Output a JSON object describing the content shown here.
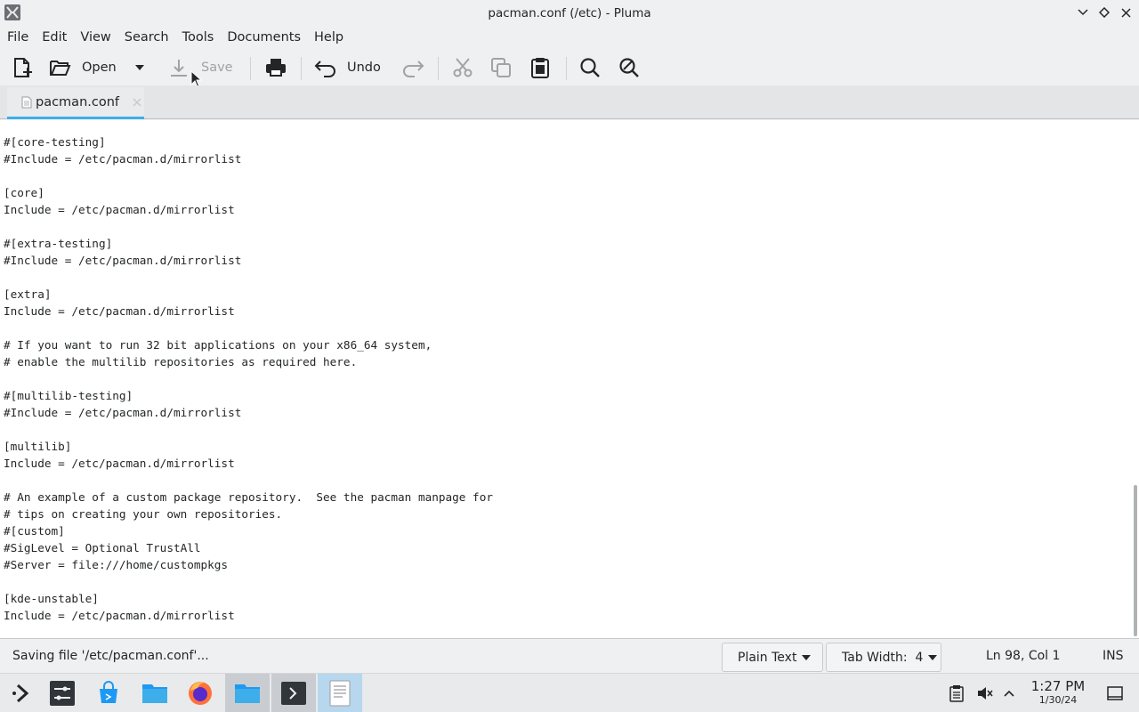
{
  "window": {
    "title": "pacman.conf (/etc) - Pluma"
  },
  "menu": [
    "File",
    "Edit",
    "View",
    "Search",
    "Tools",
    "Documents",
    "Help"
  ],
  "toolbar": {
    "open_label": "Open",
    "save_label": "Save",
    "undo_label": "Undo"
  },
  "tab": {
    "label": "pacman.conf"
  },
  "editor": {
    "lines": [
      "#[core-testing]",
      "#Include = /etc/pacman.d/mirrorlist",
      "",
      "[core]",
      "Include = /etc/pacman.d/mirrorlist",
      "",
      "#[extra-testing]",
      "#Include = /etc/pacman.d/mirrorlist",
      "",
      "[extra]",
      "Include = /etc/pacman.d/mirrorlist",
      "",
      "# If you want to run 32 bit applications on your x86_64 system,",
      "# enable the multilib repositories as required here.",
      "",
      "#[multilib-testing]",
      "#Include = /etc/pacman.d/mirrorlist",
      "",
      "[multilib]",
      "Include = /etc/pacman.d/mirrorlist",
      "",
      "# An example of a custom package repository.  See the pacman manpage for",
      "# tips on creating your own repositories.",
      "#[custom]",
      "#SigLevel = Optional TrustAll",
      "#Server = file:///home/custompkgs",
      "",
      "[kde-unstable]",
      "Include = /etc/pacman.d/mirrorlist"
    ]
  },
  "status": {
    "message": "Saving file '/etc/pacman.conf'...",
    "language": "Plain Text",
    "tab_width": "Tab Width:  4",
    "cursor": "Ln 98, Col 1",
    "mode": "INS"
  },
  "clock": {
    "time": "1:27 PM",
    "date": "1/30/24"
  },
  "colors": {
    "accent": "#3daee9",
    "window_bg": "#eff0f1",
    "editor_bg": "#ffffff"
  }
}
